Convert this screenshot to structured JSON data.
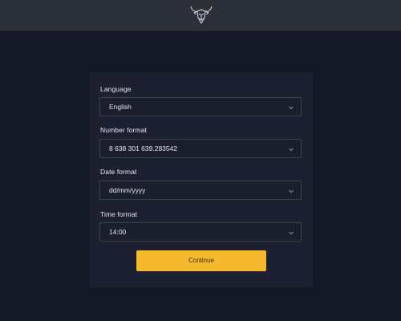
{
  "header": {
    "logo_icon": "bull-head-logo"
  },
  "form": {
    "fields": [
      {
        "label": "Language",
        "value": "English"
      },
      {
        "label": "Number format",
        "value": "8 638 301 639.283542"
      },
      {
        "label": "Date format",
        "value": "dd/mm/yyyy"
      },
      {
        "label": "Time format",
        "value": "14:00"
      }
    ],
    "continue_label": "Continue"
  },
  "colors": {
    "background": "#141726",
    "topbar": "#2c3039",
    "card": "#1d2030",
    "accent": "#f4b92d"
  }
}
